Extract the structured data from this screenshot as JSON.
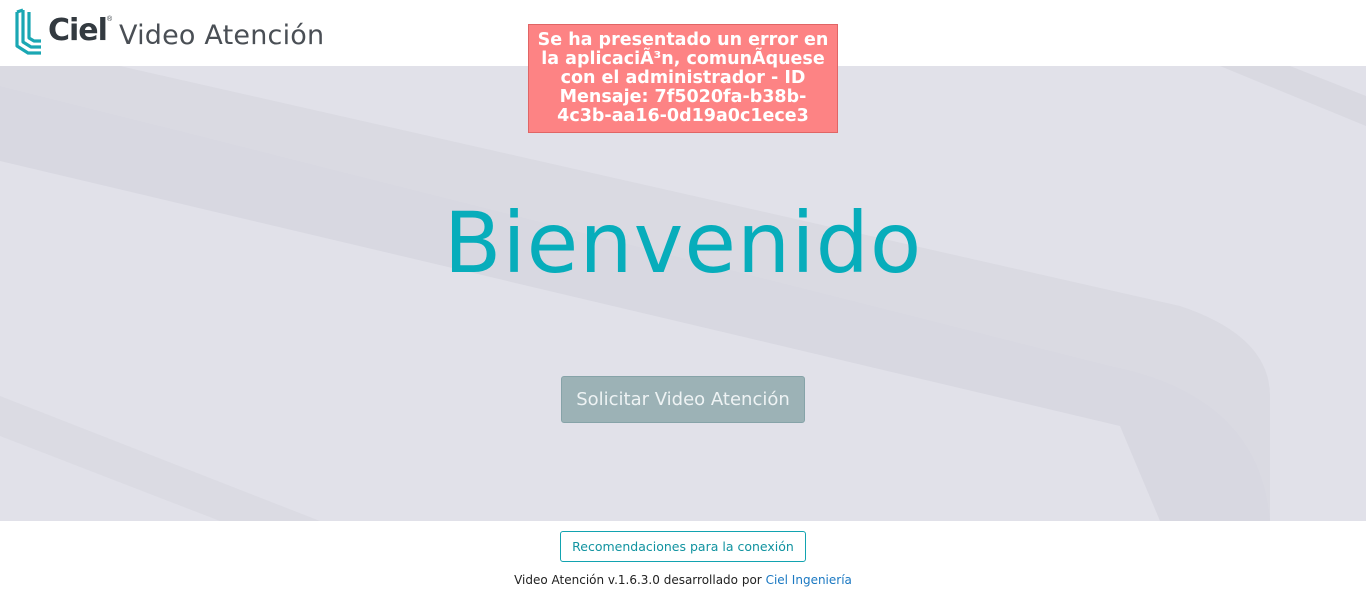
{
  "header": {
    "logo_text": "Ciel",
    "logo_mark": "®",
    "title": "Video Atención"
  },
  "error": {
    "message": "Se ha presentado un error en la aplicaciÃ³n, comunÃquese con el administrador - ID Mensaje: 7f5020fa-b38b-4c3b-aa16-0d19a0c1ece3",
    "background": "#fd8384"
  },
  "hero": {
    "welcome": "Bienvenido",
    "cta_label": "Solicitar Video Atención"
  },
  "footer": {
    "recommendations_label": "Recomendaciones para la conexión",
    "credits_prefix": "Video Atención v.1.6.3.0 desarrollado por",
    "credits_link": "Ciel Ingeniería"
  },
  "colors": {
    "accent": "#07adbb",
    "hero_bg": "#e1e1e9",
    "link": "#1a78c2"
  },
  "icons": {
    "logo": "ciel-logo-icon"
  }
}
